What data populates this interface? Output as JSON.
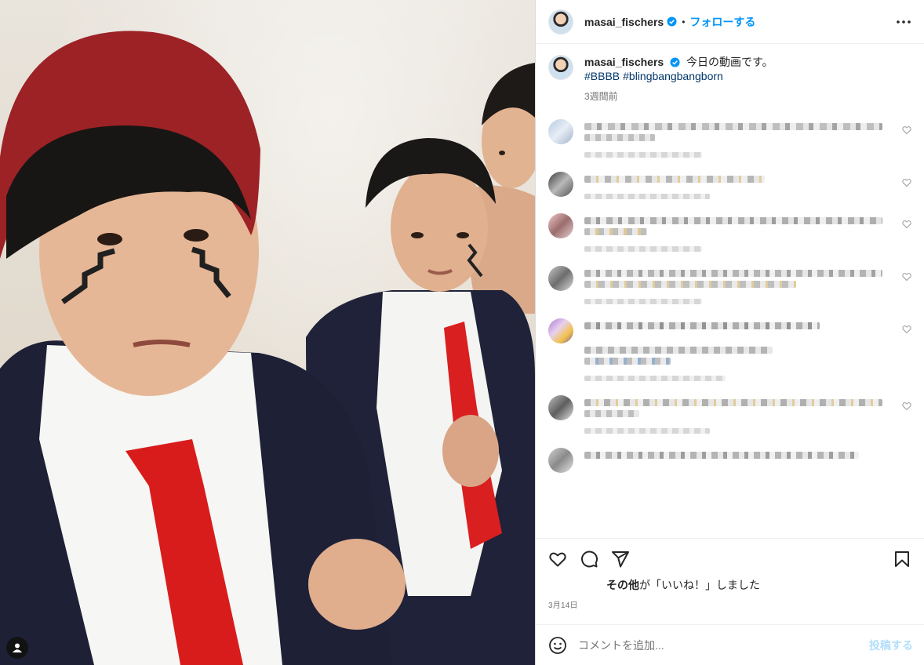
{
  "post": {
    "username": "masai_fischers",
    "separator": "•",
    "follow_label": "フォローする",
    "caption_text": "今日の動画です。",
    "hashtags": [
      "#BBBB",
      "#blingbangbangborn"
    ],
    "caption_time": "3週間前",
    "likes_prefix": "その他",
    "likes_suffix": "が「いいね！」しました",
    "date": "3月14日",
    "comment_placeholder": "コメントを追加...",
    "post_label": "投稿する"
  },
  "colors": {
    "accent": "#0095f6",
    "verified": "#0095f6",
    "hashtag": "#00376b",
    "post_disabled": "#b2dffc",
    "muted": "#737373"
  },
  "icons": {
    "header_more": "more-horizontal-icon",
    "verified": "verified-badge-icon",
    "like": "heart-icon",
    "comment": "comment-bubble-icon",
    "share": "paper-plane-icon",
    "save": "bookmark-icon",
    "emoji": "smiley-icon",
    "user_tag": "user-tag-icon"
  }
}
